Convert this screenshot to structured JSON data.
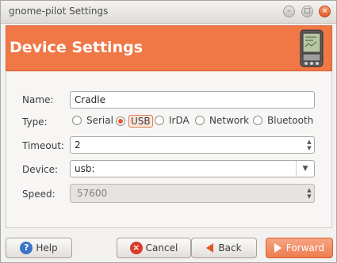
{
  "window": {
    "title": "gnome-pilot Settings",
    "buttons": {
      "minimize": "–",
      "maximize": "□",
      "close": "×"
    }
  },
  "header": {
    "title": "Device Settings",
    "accent_color": "#f07746",
    "icon": "pda-device-icon"
  },
  "form": {
    "name": {
      "label": "Name:",
      "value": "Cradle"
    },
    "type": {
      "label": "Type:",
      "options": [
        "Serial",
        "USB",
        "IrDA",
        "Network",
        "Bluetooth"
      ],
      "selected": "USB"
    },
    "timeout": {
      "label": "Timeout:",
      "value": "2"
    },
    "device": {
      "label": "Device:",
      "value": "usb:"
    },
    "speed": {
      "label": "Speed:",
      "value": "57600",
      "disabled": true
    }
  },
  "buttons": {
    "help": "Help",
    "cancel": "Cancel",
    "back": "Back",
    "forward": "Forward"
  }
}
